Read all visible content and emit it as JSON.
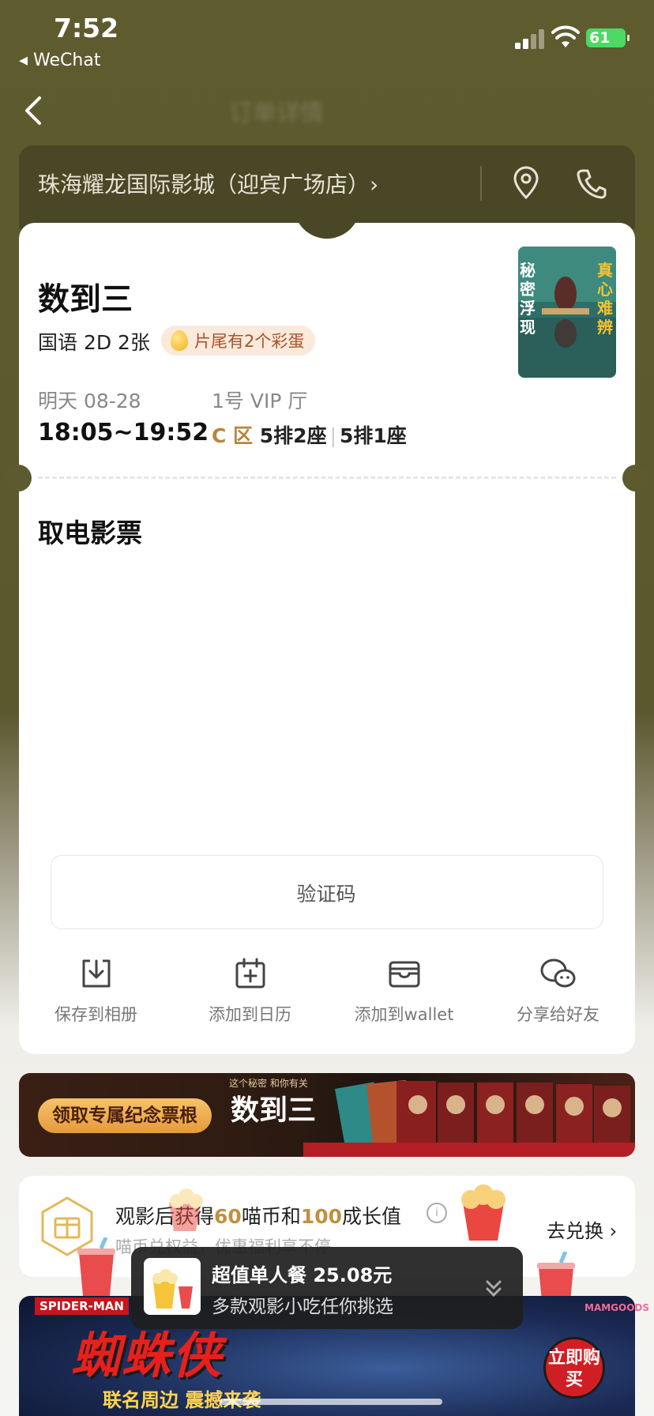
{
  "status_bar": {
    "time": "7:52",
    "back_app": "◂ WeChat",
    "battery": "61"
  },
  "nav": {
    "title": "订单详情"
  },
  "cinema": {
    "name": "珠海耀龙国际影城（迎宾广场店）›"
  },
  "ticket": {
    "movie_title": "数到三",
    "format": "国语 2D 2张",
    "egg_badge": "片尾有2个彩蛋",
    "date_label": "明天 08-28",
    "hall_label": "1号 VIP 厅",
    "show_time": "18:05~19:52",
    "zone": "C 区",
    "seat1": "5排2座",
    "seat2": "5排1座",
    "poster": {
      "text_left": "秘密浮现",
      "text_right": "真心难辨"
    }
  },
  "pickup": {
    "title": "取电影票",
    "code_label": "验证码"
  },
  "actions": [
    {
      "label": "保存到相册",
      "icon": "download-icon"
    },
    {
      "label": "添加到日历",
      "icon": "calendar-add-icon"
    },
    {
      "label": "添加到wallet",
      "icon": "wallet-icon"
    },
    {
      "label": "分享给好友",
      "icon": "wechat-icon"
    }
  ],
  "ticket_banner": {
    "button": "领取专属纪念票根",
    "tag": "这个秘密 和你有关",
    "logo": "数到三"
  },
  "reward": {
    "text_pre": "观影后获得",
    "coin_amount": "60",
    "text_mid": "喵币和",
    "growth_amount": "100",
    "text_post": "成长值",
    "sub": "喵币兑权益，优惠福利享不停",
    "action": "去兑换 ›"
  },
  "combo": {
    "title": "超值单人餐 25.08元",
    "sub": "多款观影小吃任你挑选"
  },
  "spider_banner": {
    "brand": "SPIDER-MAN",
    "title": "蜘蛛侠",
    "sub": "联名周边 震撼来袭",
    "buy": "立即购买",
    "shop": "MAMGOODS"
  },
  "colors": {
    "bg_olive": "#5e5b2f",
    "header_dark": "#4a4726",
    "gold": "#b6863d"
  }
}
